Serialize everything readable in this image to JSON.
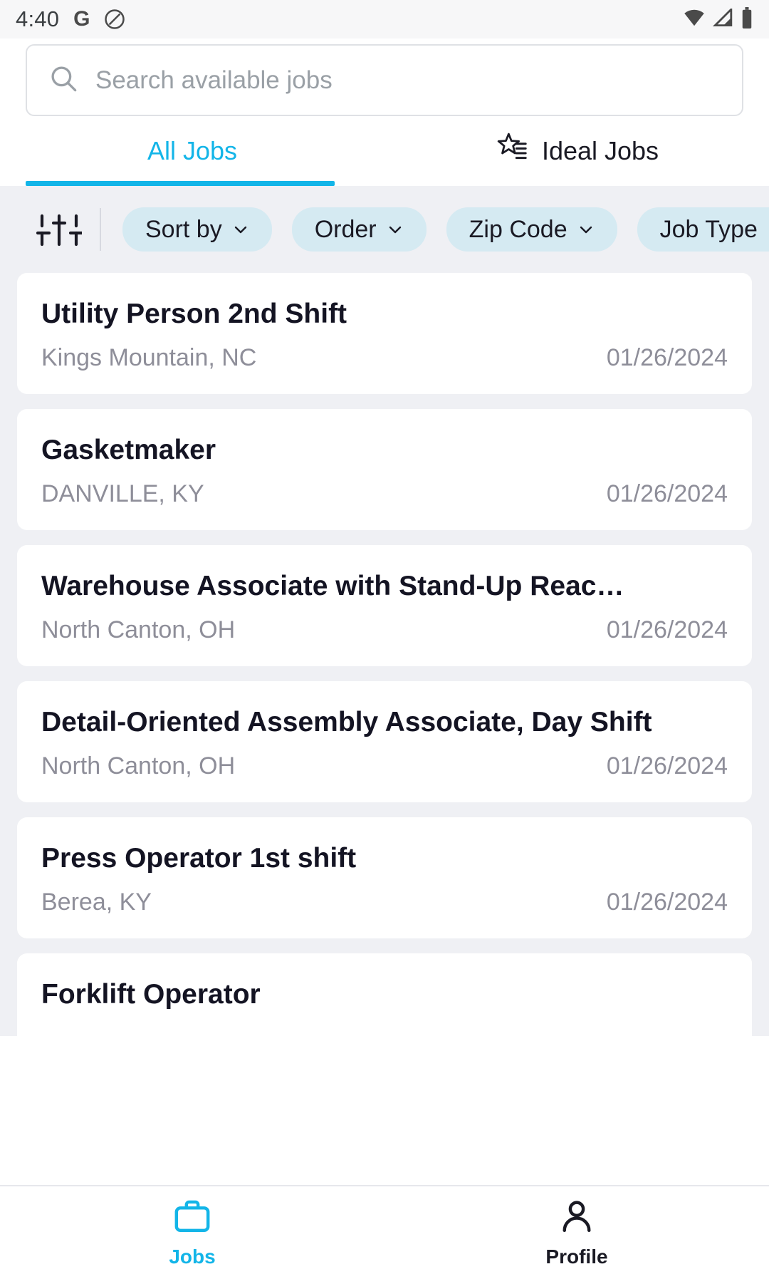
{
  "status_bar": {
    "time": "4:40",
    "left_icons": [
      "google-icon",
      "do-not-disturb-icon"
    ],
    "right_icons": [
      "wifi-icon",
      "cellular-signal-icon",
      "battery-icon"
    ]
  },
  "search": {
    "placeholder": "Search available jobs",
    "value": "",
    "icon": "search-icon"
  },
  "tabs": [
    {
      "label": "All Jobs",
      "active": true,
      "icon": null
    },
    {
      "label": "Ideal Jobs",
      "active": false,
      "icon": "star-list-icon"
    }
  ],
  "filters": {
    "icon": "tune-filter-icon",
    "chips": [
      {
        "label": "Sort by",
        "icon": "chevron-down-icon"
      },
      {
        "label": "Order",
        "icon": "chevron-down-icon"
      },
      {
        "label": "Zip Code",
        "icon": "chevron-down-icon"
      },
      {
        "label": "Job Type",
        "icon": "chevron-down-icon"
      }
    ]
  },
  "jobs": [
    {
      "title": "Utility Person 2nd Shift",
      "location": "Kings Mountain, NC",
      "date": "01/26/2024"
    },
    {
      "title": "Gasketmaker",
      "location": "DANVILLE, KY",
      "date": "01/26/2024"
    },
    {
      "title": "Warehouse Associate with Stand-Up Reac…",
      "location": "North Canton, OH",
      "date": "01/26/2024"
    },
    {
      "title": "Detail-Oriented Assembly Associate, Day Shift",
      "location": "North Canton, OH",
      "date": "01/26/2024"
    },
    {
      "title": "Press Operator 1st shift",
      "location": "Berea, KY",
      "date": "01/26/2024"
    },
    {
      "title": "Forklift Operator",
      "location": "",
      "date": ""
    }
  ],
  "bottom_nav": [
    {
      "label": "Jobs",
      "icon": "briefcase-icon",
      "active": true
    },
    {
      "label": "Profile",
      "icon": "person-icon",
      "active": false
    }
  ],
  "colors": {
    "accent": "#13b5e8",
    "chip_bg": "#d5eaf2",
    "page_bg": "#eff0f4",
    "card_bg": "#ffffff",
    "muted_text": "#8e8e99",
    "title_text": "#141423"
  }
}
